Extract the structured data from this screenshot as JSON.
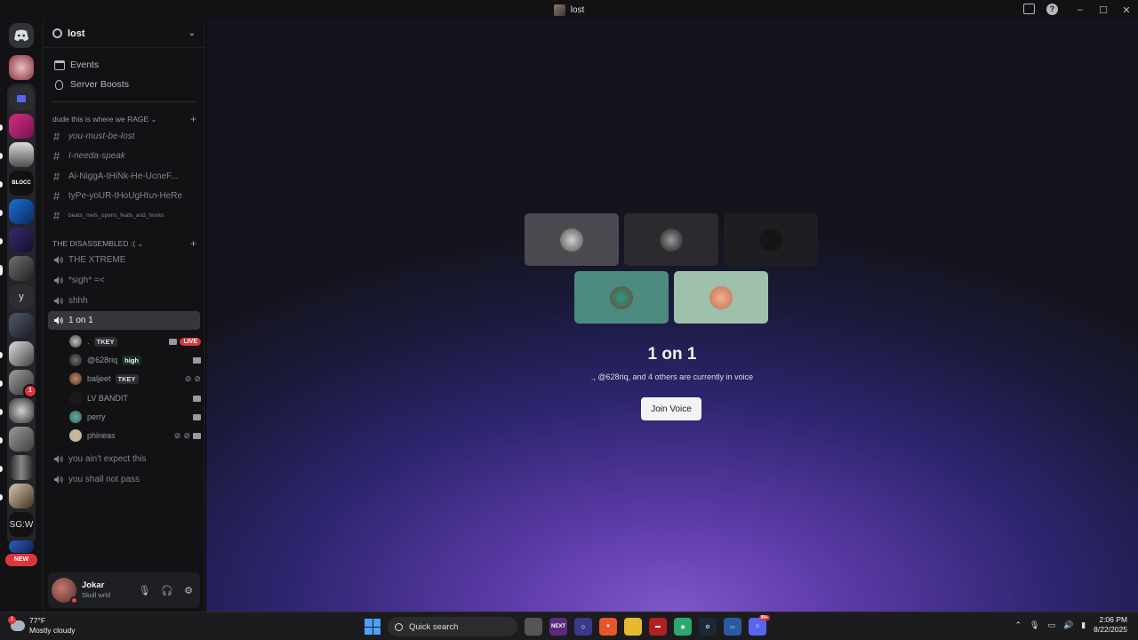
{
  "window": {
    "title": "lost"
  },
  "server": {
    "name": "lost",
    "nav": [
      {
        "label": "Events",
        "icon": "calendar-icon"
      },
      {
        "label": "Server Boosts",
        "icon": "boost-icon"
      }
    ],
    "categories": [
      {
        "name": "dude this is where we RAGE",
        "channels": [
          {
            "name": "you-must-be-lost",
            "type": "text"
          },
          {
            "name": "I-needa-speak",
            "type": "text"
          },
          {
            "name": "Ai-ÑiggA-tHiÑk-He-UcneF...",
            "type": "text"
          },
          {
            "name": "tyPe-yoUR-tHoUgHtഗ-HeRe",
            "type": "text"
          },
          {
            "name": "beats_mels_opens_feats_and_hooks",
            "type": "text"
          }
        ]
      },
      {
        "name": "THE DISASSEMBLED :(",
        "channels": [
          {
            "name": "THE XTREME",
            "type": "voice"
          },
          {
            "name": "*sigh* =<",
            "type": "voice"
          },
          {
            "name": "shhh",
            "type": "voice"
          },
          {
            "name": "1 on 1",
            "type": "voice",
            "active": true
          },
          {
            "name": "you ain't expect this",
            "type": "voice"
          },
          {
            "name": "you shall not pass",
            "type": "voice"
          }
        ]
      }
    ]
  },
  "voice_users": [
    {
      "name": ".",
      "tag": "TKEY",
      "live": "LIVE"
    },
    {
      "name": "@628riq",
      "tag": "high"
    },
    {
      "name": "baljeet",
      "tag": "TKEY"
    },
    {
      "name": "LV BANDIT",
      "tag": ""
    },
    {
      "name": "perry",
      "tag": ""
    },
    {
      "name": "phineas",
      "tag": ""
    }
  ],
  "user": {
    "name": "Jokar",
    "status": "Skull wrld"
  },
  "stage": {
    "title": "1 on 1",
    "subtitle": "., @628riq, and 4 others are currently in voice",
    "join_label": "Join Voice"
  },
  "rail": {
    "new_label": "NEW",
    "badge_count": "1",
    "y_label": "y",
    "sgw_label": "SG:W"
  },
  "taskbar": {
    "weather_temp": "77°F",
    "weather_desc": "Mostly cloudy",
    "weather_badge": "1",
    "search_placeholder": "Quick search",
    "time": "2:06 PM",
    "date": "8/22/2025",
    "discord_badge": "99+"
  },
  "colors": {
    "accent": "#5865f2",
    "live": "#da373c",
    "background": "#121214"
  }
}
